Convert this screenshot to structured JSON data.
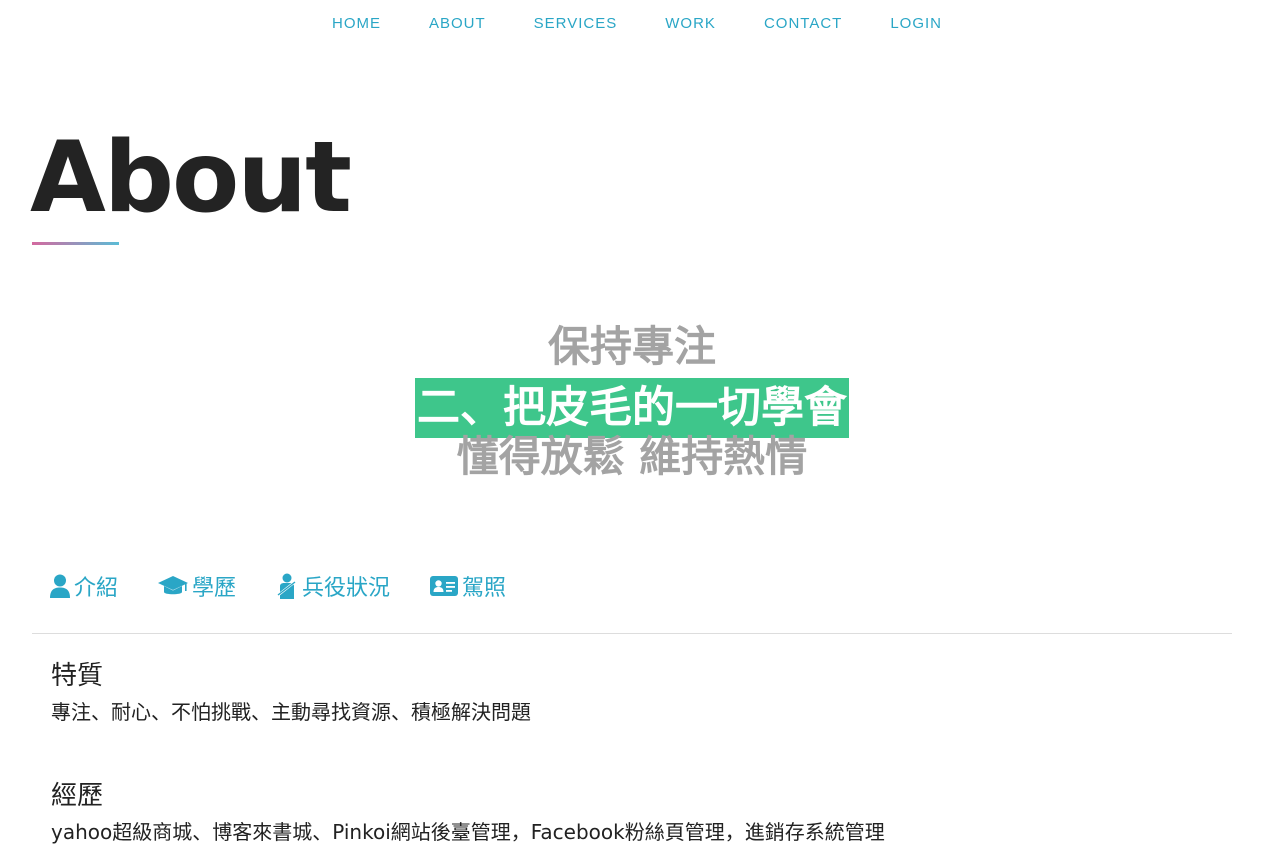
{
  "nav": {
    "home": "HOME",
    "about": "ABOUT",
    "services": "SERVICES",
    "work": "WORK",
    "contact": "CONTACT",
    "login": "LOGIN"
  },
  "page": {
    "title": "About"
  },
  "motto": {
    "line1": "保持專注",
    "line2": "二、把皮毛的一切學會",
    "line3": "懂得放鬆 維持熱情"
  },
  "tabs": [
    {
      "label": "介紹",
      "icon": "user-icon"
    },
    {
      "label": "學歷",
      "icon": "graduation-cap-icon"
    },
    {
      "label": "兵役狀況",
      "icon": "soldier-icon"
    },
    {
      "label": "駕照",
      "icon": "id-card-icon"
    }
  ],
  "sections": [
    {
      "heading": "特質",
      "body": "專注、耐心、不怕挑戰、主動尋找資源、積極解決問題"
    },
    {
      "heading": "經歷",
      "body": "yahoo超級商城、博客來書城、Pinkoi網站後臺管理，Facebook粉絲頁管理，進銷存系統管理"
    }
  ],
  "colors": {
    "accent": "#2aa6c6",
    "highlight": "#3ec68b",
    "motto_gray": "#a3a3a3",
    "underline_start": "#d4699f",
    "underline_end": "#5bbcd6"
  }
}
